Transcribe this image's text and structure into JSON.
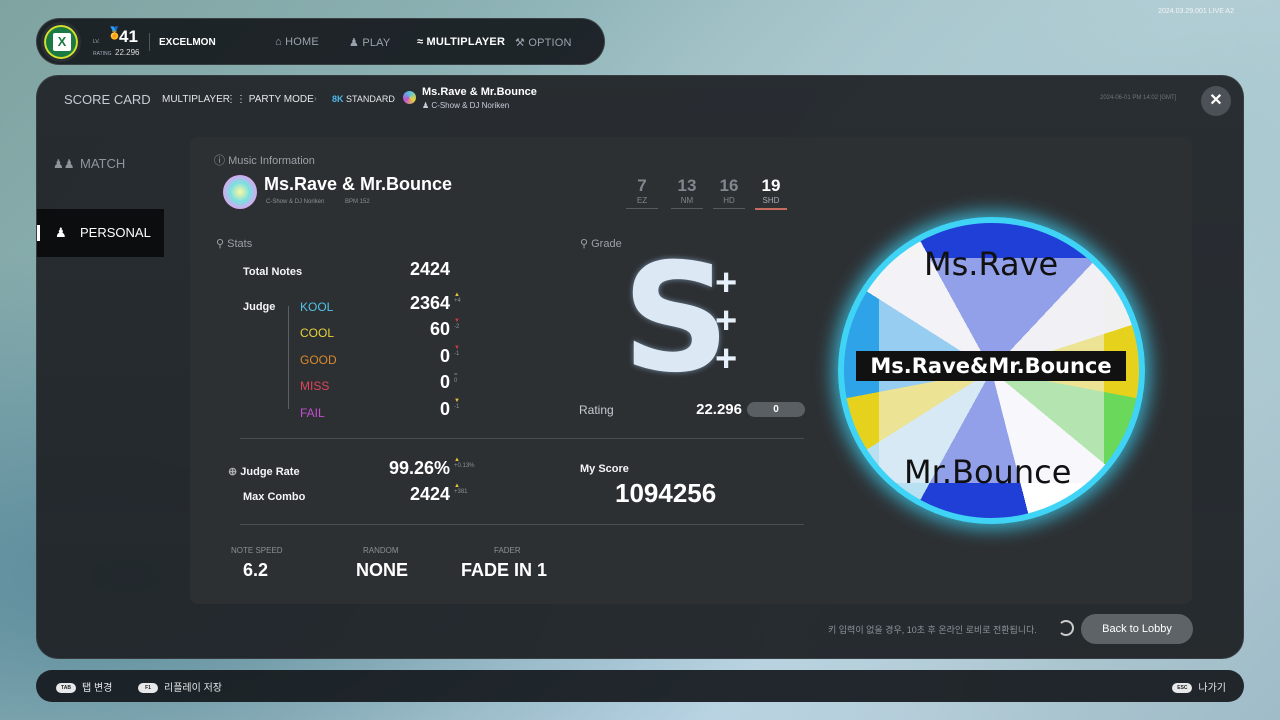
{
  "build": "2024.03.29.001 LIVE A2",
  "top": {
    "level": "41",
    "rating_label": "RATING",
    "rating": "22.296",
    "player": "EXCELMON",
    "nav": [
      {
        "label": "HOME",
        "icon": "home-icon",
        "active": false
      },
      {
        "label": "PLAY",
        "icon": "person-icon",
        "active": false
      },
      {
        "label": "MULTIPLAYER",
        "icon": "signal-icon",
        "active": true
      },
      {
        "label": "OPTION",
        "icon": "wrench-icon",
        "active": false
      }
    ]
  },
  "header": {
    "title": "SCORE CARD",
    "mode": "MULTIPLAYER",
    "party": "PARTY MODE",
    "keys": "8K",
    "difficulty_mode": "STANDARD",
    "song": "Ms.Rave & Mr.Bounce",
    "artist": "C-Show & DJ Noriken",
    "timestamp": "2024-06-01 PM 14:02 [GMT]"
  },
  "sidebar": [
    {
      "label": "MATCH",
      "icon": "group-icon",
      "active": false
    },
    {
      "label": "PERSONAL",
      "icon": "user-icon",
      "active": true
    }
  ],
  "music": {
    "section": "Music Information",
    "title": "Ms.Rave & Mr.Bounce",
    "artist": "C-Show & DJ Noriken",
    "bpm": "BPM 152",
    "difficulties": [
      {
        "level": "7",
        "name": "EZ",
        "active": false
      },
      {
        "level": "13",
        "name": "NM",
        "active": false
      },
      {
        "level": "16",
        "name": "HD",
        "active": false
      },
      {
        "level": "19",
        "name": "SHD",
        "active": true
      }
    ]
  },
  "stats": {
    "section": "Stats",
    "total_label": "Total Notes",
    "total": "2424",
    "judge_label": "Judge",
    "judges": [
      {
        "name": "KOOL",
        "color": "#4fc3e8",
        "value": "2364",
        "delta": "+4",
        "dir": "up"
      },
      {
        "name": "COOL",
        "color": "#e8d23a",
        "value": "60",
        "delta": "-2",
        "dir": "down"
      },
      {
        "name": "GOOD",
        "color": "#d98a2b",
        "value": "0",
        "delta": "-1",
        "dir": "down"
      },
      {
        "name": "MISS",
        "color": "#e0455a",
        "value": "0",
        "delta": "0",
        "dir": "same"
      },
      {
        "name": "FAIL",
        "color": "#c24fd0",
        "value": "0",
        "delta": "-1",
        "dir": "up"
      }
    ],
    "rate_label": "Judge Rate",
    "rate": "99.26%",
    "rate_delta": "+0.13%",
    "combo_label": "Max Combo",
    "combo": "2424",
    "combo_delta": "+381"
  },
  "grade": {
    "section": "Grade",
    "letter": "S",
    "plus": "+++",
    "rating_label": "Rating",
    "rating": "22.296",
    "rating_badge": "0",
    "score_label": "My Score",
    "score": "1094256"
  },
  "settings": [
    {
      "label": "NOTE SPEED",
      "value": "6.2"
    },
    {
      "label": "RANDOM",
      "value": "NONE"
    },
    {
      "label": "FADER",
      "value": "FADE IN 1"
    }
  ],
  "jacket": {
    "line1": "Ms.Rave",
    "line2": "Ms.Rave&Mr.Bounce",
    "line3": "Mr.Bounce"
  },
  "notice": "키 입력이 없을 경우, 10초 후 온라인 로비로 전환됩니다.",
  "lobby_button": "Back to Lobby",
  "footer": [
    {
      "key": "TAB",
      "label": "탭 변경"
    },
    {
      "key": "F1",
      "label": "리플레이 저장"
    },
    {
      "key": "ESC",
      "label": "나가기"
    }
  ]
}
